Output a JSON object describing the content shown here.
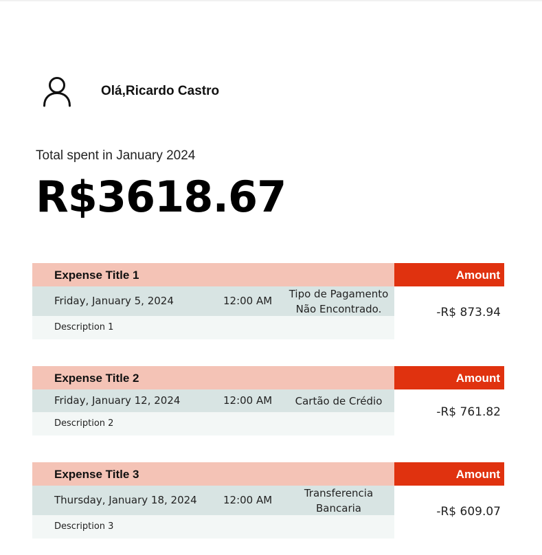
{
  "user": {
    "greeting": "Olá,Ricardo Castro",
    "avatar_icon": "user-outline-icon"
  },
  "summary": {
    "label": "Total spent in January 2024",
    "total": "R$3618.67"
  },
  "colors": {
    "title_bar": "#f4c3b6",
    "amount_bar": "#e0320f",
    "info_bar": "#d8e4e3",
    "desc_bar": "#f3f7f6"
  },
  "expenses": [
    {
      "title": "Expense Title 1",
      "amount_label": "Amount",
      "date": "Friday, January 5, 2024",
      "time": "12:00 AM",
      "payment": "Tipo de Pagamento Não Encontrado.",
      "description": "Description 1",
      "amount": "-R$ 873.94"
    },
    {
      "title": "Expense Title 2",
      "amount_label": "Amount",
      "date": "Friday, January 12, 2024",
      "time": "12:00 AM",
      "payment": "Cartão de Crédio",
      "description": "Description 2",
      "amount": "-R$ 761.82"
    },
    {
      "title": "Expense Title 3",
      "amount_label": "Amount",
      "date": "Thursday, January 18, 2024",
      "time": "12:00 AM",
      "payment": "Transferencia Bancaria",
      "description": "Description 3",
      "amount": "-R$ 609.07"
    }
  ]
}
